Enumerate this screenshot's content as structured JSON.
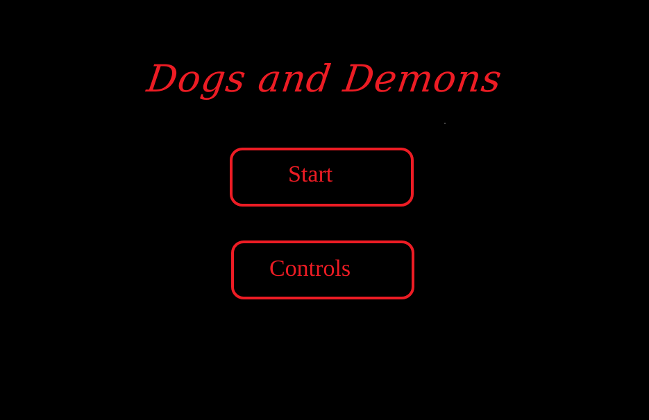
{
  "game": {
    "title": "Dogs and Demons",
    "accent_color": "#ed1c24",
    "background_color": "#000000"
  },
  "menu": {
    "start_label": "Start",
    "controls_label": "Controls"
  }
}
